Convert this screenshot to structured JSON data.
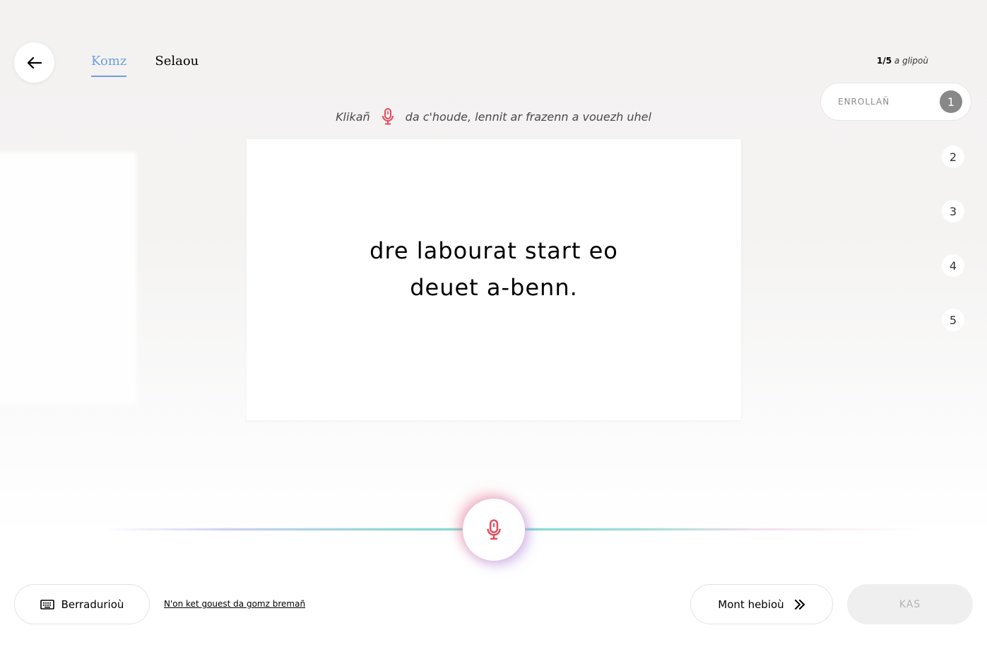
{
  "nav": {
    "back_icon": "arrow-left-icon",
    "tabs": [
      {
        "label": "Komz",
        "active": true
      },
      {
        "label": "Selaou",
        "active": false
      }
    ]
  },
  "hint": {
    "before": "Klikañ",
    "icon": "microphone-icon",
    "after": "da c'houde, lennit ar frazenn a vouezh uhel"
  },
  "card": {
    "sentence": "dre labourat start eo deuet a-benn."
  },
  "progress": {
    "current": "1/5",
    "label": "a glipoù",
    "steps": [
      {
        "number": "1",
        "label": "ENROLLAÑ",
        "active": true
      },
      {
        "number": "2"
      },
      {
        "number": "3"
      },
      {
        "number": "4"
      },
      {
        "number": "5"
      }
    ]
  },
  "record": {
    "icon": "microphone-icon",
    "accent_color": "#e8495a"
  },
  "footer": {
    "shortcuts_label": "Berradurioù",
    "shortcuts_icon": "keyboard-icon",
    "cant_speak_label": "N'on ket gouest da gomz bremañ",
    "skip_label": "Mont hebioù",
    "skip_icon": "double-chevron-right-icon",
    "submit_label": "KAS"
  },
  "colors": {
    "tab_active": "#6f9ee0",
    "mic_red": "#e8495a",
    "submit_disabled_bg": "#efefef",
    "submit_disabled_text": "#b3b3b3"
  }
}
